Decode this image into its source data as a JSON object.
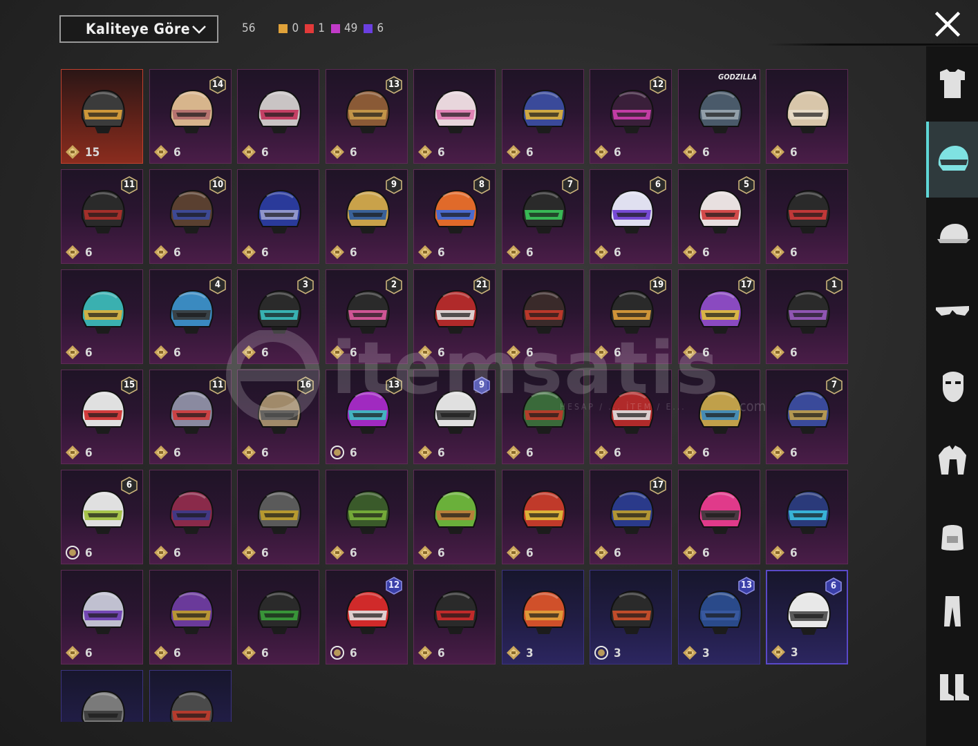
{
  "sort": {
    "label": "Kaliteye Göre"
  },
  "counts": {
    "total": "56",
    "by_quality": [
      {
        "color": "#e0a23a",
        "value": "0"
      },
      {
        "color": "#e23a3a",
        "value": "1"
      },
      {
        "color": "#c23bc8",
        "value": "49"
      },
      {
        "color": "#6a3fe0",
        "value": "6"
      }
    ]
  },
  "items": [
    {
      "price": "15",
      "level": "",
      "quality": "red",
      "color": "#3b3b3b",
      "accent": "#e0a23a"
    },
    {
      "price": "6",
      "level": "14",
      "quality": "pink",
      "color": "#d7b58c",
      "accent": "#b26c6c"
    },
    {
      "price": "6",
      "level": "",
      "quality": "pink",
      "color": "#c9c4c4",
      "accent": "#c2325a"
    },
    {
      "price": "6",
      "level": "13",
      "quality": "pink",
      "color": "#8a5a36",
      "accent": "#c79a4a"
    },
    {
      "price": "6",
      "level": "",
      "quality": "pink",
      "color": "#e8d6dc",
      "accent": "#e07ab0"
    },
    {
      "price": "6",
      "level": "",
      "quality": "pink",
      "color": "#3a4a9a",
      "accent": "#e0b23a"
    },
    {
      "price": "6",
      "level": "12",
      "quality": "pink",
      "color": "#3a1f3a",
      "accent": "#d23fb0"
    },
    {
      "price": "6",
      "level": "",
      "tag": "GODZILLA",
      "quality": "pink",
      "color": "#4a5a6a",
      "accent": "#9aa6b0"
    },
    {
      "price": "6",
      "level": "",
      "quality": "pink",
      "color": "#d8c6aa",
      "accent": "#e8dcc8"
    },
    {
      "price": "6",
      "level": "11",
      "quality": "pink",
      "color": "#2a2a2a",
      "accent": "#b0302a"
    },
    {
      "price": "6",
      "level": "10",
      "quality": "pink",
      "color": "#5a4030",
      "accent": "#3a4aa0"
    },
    {
      "price": "6",
      "level": "",
      "quality": "pink",
      "color": "#2a3a9a",
      "accent": "#9aa0d0"
    },
    {
      "price": "6",
      "level": "9",
      "quality": "pink",
      "color": "#c9a24a",
      "accent": "#2a5aa0"
    },
    {
      "price": "6",
      "level": "8",
      "quality": "pink",
      "color": "#e06a2a",
      "accent": "#3a6ae0"
    },
    {
      "price": "6",
      "level": "7",
      "quality": "pink",
      "color": "#2a2a2a",
      "accent": "#3ac85a"
    },
    {
      "price": "6",
      "level": "6",
      "quality": "pink",
      "color": "#e0e0f0",
      "accent": "#6a3ad0"
    },
    {
      "price": "6",
      "level": "5",
      "quality": "pink",
      "color": "#e8e0e0",
      "accent": "#d03a3a"
    },
    {
      "price": "6",
      "level": "",
      "quality": "pink",
      "color": "#2a2a2a",
      "accent": "#d03a3a"
    },
    {
      "price": "6",
      "level": "",
      "quality": "pink",
      "color": "#3ab0b0",
      "accent": "#e0b03a"
    },
    {
      "price": "6",
      "level": "4",
      "quality": "pink",
      "color": "#3a8ac0",
      "accent": "#3a3a3a"
    },
    {
      "price": "6",
      "level": "3",
      "quality": "pink",
      "color": "#2a2a2a",
      "accent": "#3ac0c0"
    },
    {
      "price": "6",
      "level": "2",
      "quality": "pink",
      "color": "#2a2a2a",
      "accent": "#e05aa0"
    },
    {
      "price": "6",
      "level": "21",
      "quality": "pink",
      "color": "#b02a2a",
      "accent": "#e0e0e0"
    },
    {
      "price": "6",
      "level": "",
      "quality": "pink",
      "color": "#3a2a2a",
      "accent": "#c83a2a"
    },
    {
      "price": "6",
      "level": "19",
      "quality": "pink",
      "color": "#2a2a2a",
      "accent": "#e0a03a"
    },
    {
      "price": "6",
      "level": "17",
      "quality": "pink",
      "color": "#8a4ac0",
      "accent": "#e0c03a"
    },
    {
      "price": "6",
      "level": "1",
      "quality": "pink",
      "color": "#2a2a2a",
      "accent": "#9a5ac0"
    },
    {
      "price": "6",
      "level": "15",
      "quality": "pink",
      "color": "#e0e0e0",
      "accent": "#d02a2a"
    },
    {
      "price": "6",
      "level": "11",
      "quality": "pink",
      "color": "#8a8aa0",
      "accent": "#d03a3a"
    },
    {
      "price": "6",
      "level": "16",
      "quality": "pink",
      "color": "#a08a6a",
      "accent": "#3a3a3a"
    },
    {
      "price": "6",
      "level": "13",
      "quality": "pink",
      "color": "#a02ac0",
      "accent": "#3ac0c0",
      "coin": "ring"
    },
    {
      "price": "6",
      "level": "9",
      "level_style": "blue",
      "quality": "pink",
      "color": "#e0e0e0",
      "accent": "#3a3a3a"
    },
    {
      "price": "6",
      "level": "",
      "quality": "pink",
      "color": "#3a6a3a",
      "accent": "#c03a2a"
    },
    {
      "price": "6",
      "level": "",
      "quality": "pink",
      "color": "#b02a2a",
      "accent": "#e0e0e0"
    },
    {
      "price": "6",
      "level": "",
      "quality": "pink",
      "color": "#c0a04a",
      "accent": "#3a8ac0"
    },
    {
      "price": "6",
      "level": "7",
      "quality": "pink",
      "color": "#3a4a9a",
      "accent": "#c0a04a"
    },
    {
      "price": "6",
      "level": "6",
      "quality": "pink",
      "color": "#e0e0e0",
      "accent": "#a0c03a",
      "coin": "ring"
    },
    {
      "price": "6",
      "level": "",
      "quality": "pink",
      "color": "#8a2a4a",
      "accent": "#3a3a8a"
    },
    {
      "price": "6",
      "level": "",
      "quality": "pink",
      "color": "#5a5a5a",
      "accent": "#c0a02a"
    },
    {
      "price": "6",
      "level": "",
      "quality": "pink",
      "color": "#3a5a2a",
      "accent": "#7ab03a"
    },
    {
      "price": "6",
      "level": "",
      "quality": "pink",
      "color": "#6ab03a",
      "accent": "#c07a3a"
    },
    {
      "price": "6",
      "level": "",
      "quality": "pink",
      "color": "#c03a2a",
      "accent": "#e0c03a"
    },
    {
      "price": "6",
      "level": "17",
      "quality": "pink",
      "color": "#2a3a8a",
      "accent": "#c0a02a"
    },
    {
      "price": "6",
      "level": "",
      "quality": "pink",
      "color": "#e03a8a",
      "accent": "#3a3a3a"
    },
    {
      "price": "6",
      "level": "",
      "quality": "pink",
      "color": "#2a3a7a",
      "accent": "#3ac0e0"
    },
    {
      "price": "6",
      "level": "",
      "quality": "pink",
      "color": "#c0c0d0",
      "accent": "#6a3ab0"
    },
    {
      "price": "6",
      "level": "",
      "quality": "pink",
      "color": "#6a3a9a",
      "accent": "#c0a02a"
    },
    {
      "price": "6",
      "level": "",
      "quality": "pink",
      "color": "#2a2a2a",
      "accent": "#3aa03a"
    },
    {
      "price": "6",
      "level": "12",
      "level_style": "blue",
      "quality": "pink",
      "color": "#d02a2a",
      "accent": "#e0e0e0",
      "coin": "ring"
    },
    {
      "price": "6",
      "level": "",
      "quality": "pink",
      "color": "#2a2a2a",
      "accent": "#d02a2a"
    },
    {
      "price": "3",
      "level": "",
      "quality": "purple",
      "color": "#d0502a",
      "accent": "#e0a03a"
    },
    {
      "price": "3",
      "level": "",
      "quality": "purple",
      "color": "#2a2a2a",
      "accent": "#d0502a",
      "coin": "ring"
    },
    {
      "price": "3",
      "level": "13",
      "level_style": "blue",
      "quality": "purple",
      "color": "#2a4a8a",
      "accent": "#3a5aa0"
    },
    {
      "price": "3",
      "level": "6",
      "level_style": "blue",
      "quality": "purple",
      "selected": true,
      "color": "#e8e8e8",
      "accent": "#4a4a4a"
    },
    {
      "price": "",
      "level": "",
      "quality": "purple",
      "color": "#7a7a7a",
      "accent": "#3a3a3a"
    },
    {
      "price": "",
      "level": "",
      "quality": "purple",
      "color": "#4a4a4a",
      "accent": "#c03a2a"
    }
  ],
  "nav": [
    {
      "icon": "outfit-icon"
    },
    {
      "icon": "helmet-icon",
      "active": true
    },
    {
      "icon": "cap-icon"
    },
    {
      "icon": "glasses-icon"
    },
    {
      "icon": "mask-icon"
    },
    {
      "icon": "jacket-icon"
    },
    {
      "icon": "backpack-icon"
    },
    {
      "icon": "pants-icon"
    },
    {
      "icon": "shoes-icon"
    }
  ],
  "watermark": {
    "text": "itemsatis",
    "sub": "HESAP / ... İTEM / E...",
    "suffix": ".com"
  }
}
